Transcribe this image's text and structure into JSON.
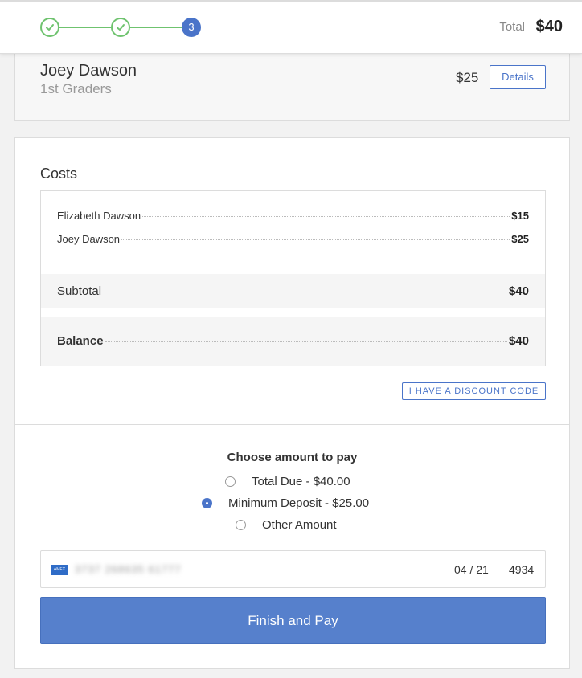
{
  "header": {
    "steps": [
      {
        "status": "done",
        "icon": "check-icon"
      },
      {
        "status": "done",
        "icon": "check-icon"
      },
      {
        "status": "current",
        "label": "3"
      }
    ],
    "total_label": "Total",
    "total_value": "$40"
  },
  "registrant": {
    "name": "Joey Dawson",
    "group": "1st Graders",
    "amount": "$25",
    "details_label": "Details"
  },
  "costs": {
    "title": "Costs",
    "items": [
      {
        "label": "Elizabeth Dawson",
        "value": "$15"
      },
      {
        "label": "Joey Dawson",
        "value": "$25"
      }
    ],
    "subtotal_label": "Subtotal",
    "subtotal_value": "$40",
    "balance_label": "Balance",
    "balance_value": "$40",
    "discount_label": "I HAVE A DISCOUNT CODE"
  },
  "payment": {
    "title": "Choose amount to pay",
    "options": [
      {
        "label": "Total Due - $40.00",
        "selected": false
      },
      {
        "label": "Minimum Deposit - $25.00",
        "selected": true
      },
      {
        "label": "Other Amount",
        "selected": false
      }
    ],
    "card": {
      "brand_icon": "amex-icon",
      "brand_text": "AMEX",
      "number_masked": "3737 268635 61777",
      "expiry": "04 / 21",
      "cvc": "4934"
    },
    "submit_label": "Finish and Pay"
  },
  "colors": {
    "accent": "#4a74c9",
    "success": "#6fc36f",
    "button": "#5680cc"
  }
}
